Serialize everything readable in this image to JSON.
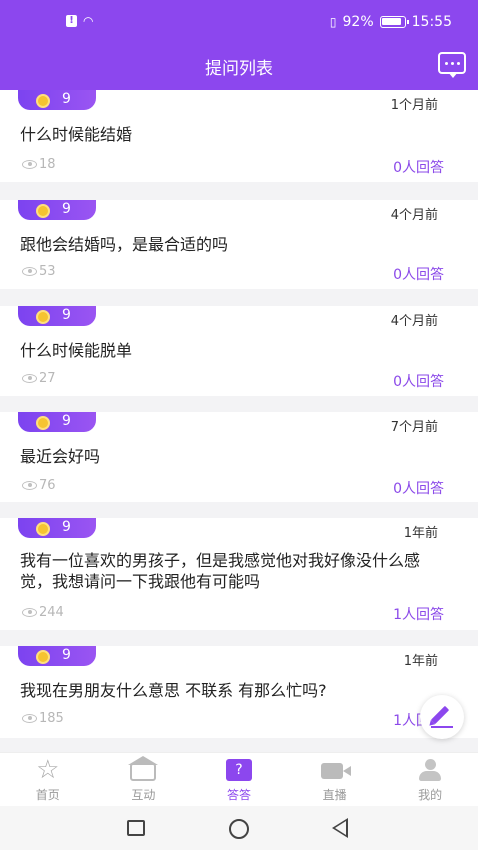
{
  "status_bar": {
    "battery": "92%",
    "time": "15:55"
  },
  "header": {
    "title": "提问列表",
    "message_icon": "chat-bubble-icon"
  },
  "questions": [
    {
      "coins": "9",
      "time": "1个月前",
      "text": "什么时候能结婚",
      "views": "18",
      "answers": "0人回答"
    },
    {
      "coins": "9",
      "time": "4个月前",
      "text": "跟他会结婚吗，是最合适的吗",
      "views": "53",
      "answers": "0人回答"
    },
    {
      "coins": "9",
      "time": "4个月前",
      "text": "什么时候能脱单",
      "views": "27",
      "answers": "0人回答"
    },
    {
      "coins": "9",
      "time": "7个月前",
      "text": "最近会好吗",
      "views": "76",
      "answers": "0人回答"
    },
    {
      "coins": "9",
      "time": "1年前",
      "text": "我有一位喜欢的男孩子，但是我感觉他对我好像没什么感觉，我想请问一下我跟他有可能吗",
      "views": "244",
      "answers": "1人回答"
    },
    {
      "coins": "9",
      "time": "1年前",
      "text": "我现在男朋友什么意思 不联系 有那么忙吗?",
      "views": "185",
      "answers": "1人回答"
    }
  ],
  "tabs": [
    {
      "label": "首页",
      "icon": "star-icon"
    },
    {
      "label": "互动",
      "icon": "house-heart-icon"
    },
    {
      "label": "答答",
      "icon": "question-box-icon",
      "active": true
    },
    {
      "label": "直播",
      "icon": "video-camera-icon"
    },
    {
      "label": "我的",
      "icon": "user-icon"
    }
  ],
  "colors": {
    "accent": "#8c47ee",
    "coin": "#f6c431"
  }
}
